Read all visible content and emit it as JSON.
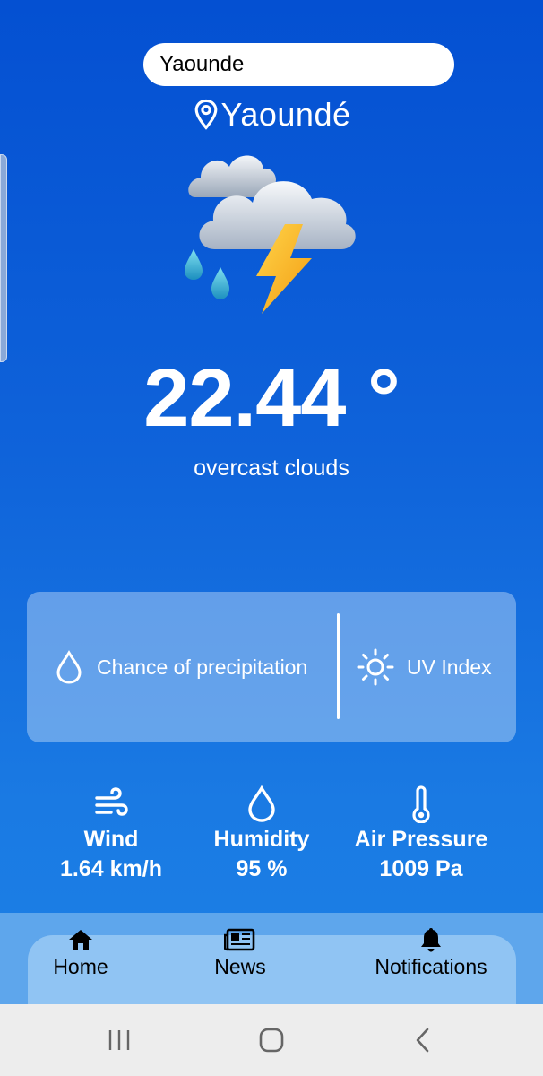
{
  "search": {
    "value": "Yaounde"
  },
  "location": {
    "city": "Yaoundé",
    "icon": "location-pin-icon"
  },
  "weather": {
    "icon": "thunderstorm-rain-icon",
    "temperature": "22.44 °",
    "description": "overcast clouds"
  },
  "card": {
    "precipitation_label": "Chance of precipitation",
    "precipitation_icon": "droplet-icon",
    "uv_label": "UV Index",
    "uv_icon": "sun-icon"
  },
  "stats": [
    {
      "label": "Wind",
      "value": "1.64 km/h",
      "icon": "wind-icon"
    },
    {
      "label": "Humidity",
      "value": "95 %",
      "icon": "droplet-icon"
    },
    {
      "label": "Air Pressure",
      "value": "1009 Pa",
      "icon": "thermometer-icon"
    }
  ],
  "nav": [
    {
      "label": "Home",
      "icon": "home-icon"
    },
    {
      "label": "News",
      "icon": "newspaper-icon"
    },
    {
      "label": "Notifications",
      "icon": "bell-icon"
    }
  ],
  "colors": {
    "background_top": "#0450d2",
    "background_bottom": "#1c80e6",
    "nav_bar": "#90c4f3",
    "text": "#ffffff"
  }
}
